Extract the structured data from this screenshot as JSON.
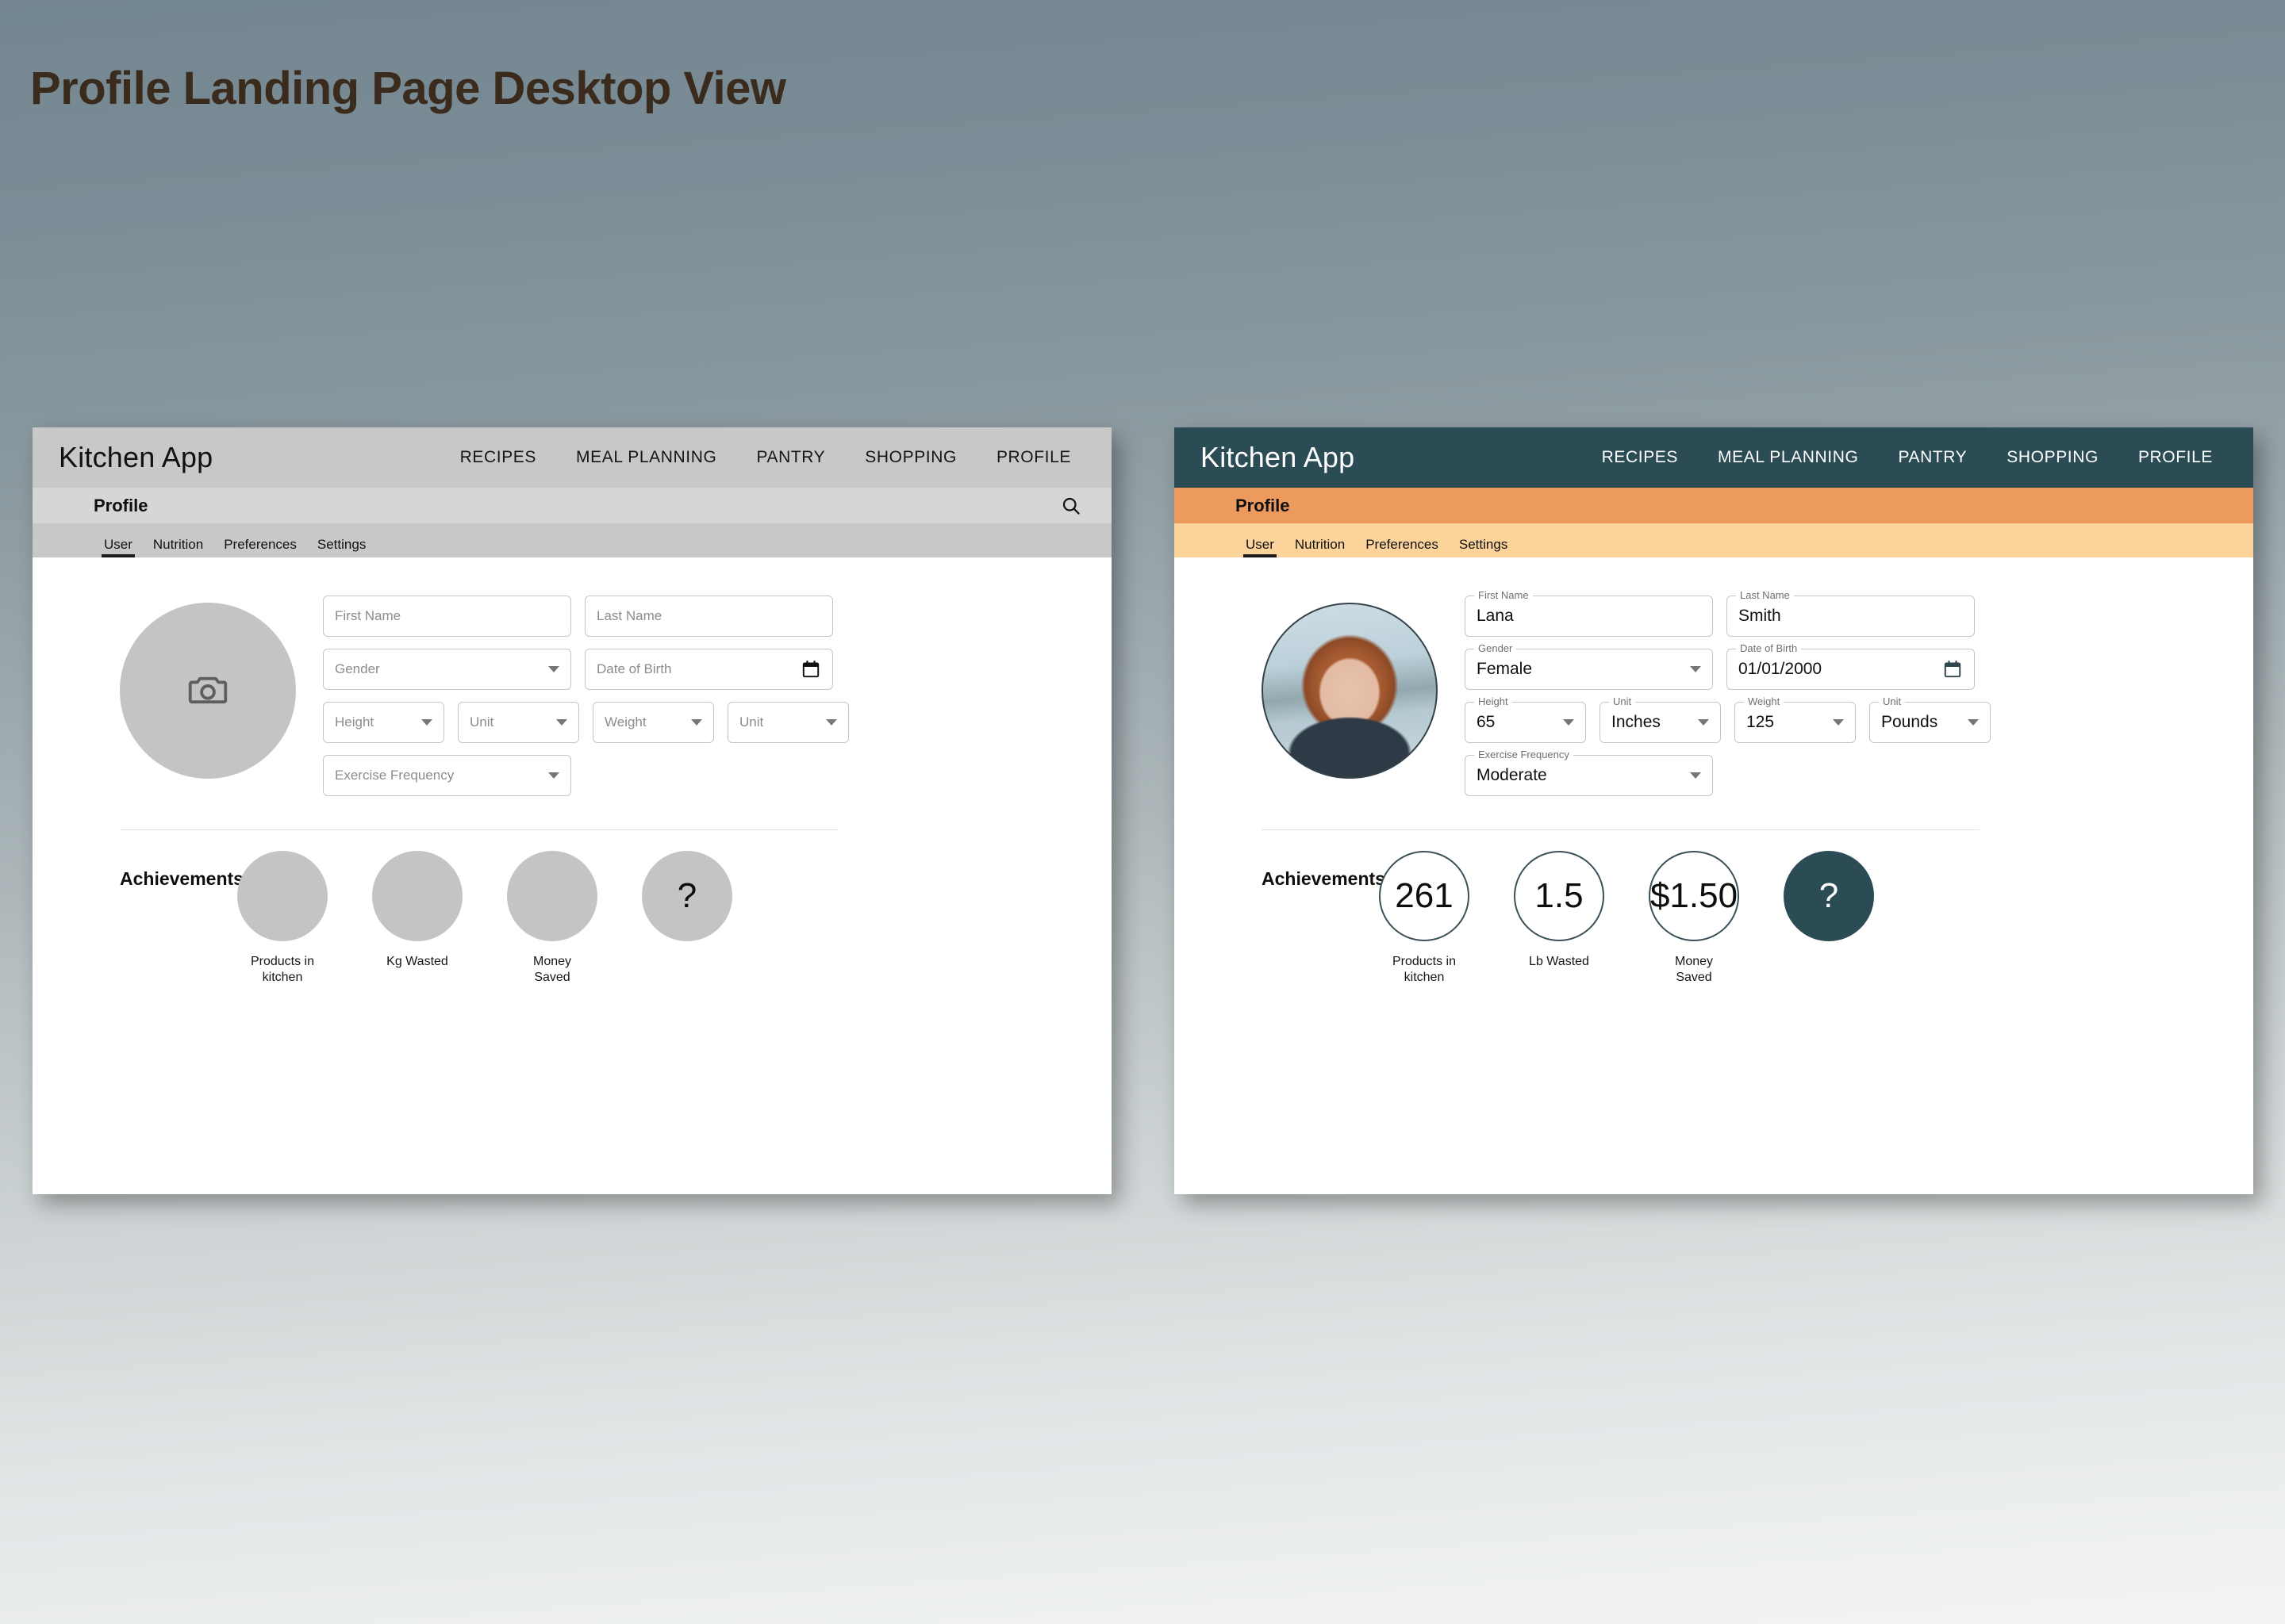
{
  "page": {
    "title": "Profile Landing Page Desktop View",
    "title_color": "#3a2b1c",
    "background_top_color": "#748791",
    "background_bottom_color": "#f2f3f4"
  },
  "mockups": [
    {
      "variant": "wireframe",
      "colors": {
        "appbar": "#c8c8c8",
        "subbar": "#d6d6d6",
        "tabbar": "#c8c8c8",
        "body": "#ffffff",
        "brand_text": "#111111",
        "nav_text": "#151515"
      },
      "appbar": {
        "brand": "Kitchen App",
        "nav": [
          {
            "label": "RECIPES"
          },
          {
            "label": "MEAL PLANNING"
          },
          {
            "label": "PANTRY"
          },
          {
            "label": "SHOPPING"
          },
          {
            "label": "PROFILE"
          }
        ]
      },
      "subbar": {
        "title": "Profile",
        "search_icon": "search-icon",
        "has_search": true
      },
      "tabs": [
        {
          "label": "User",
          "active": true
        },
        {
          "label": "Nutrition",
          "active": false
        },
        {
          "label": "Preferences",
          "active": false
        },
        {
          "label": "Settings",
          "active": false
        }
      ],
      "avatar": {
        "type": "placeholder",
        "icon": "camera-icon"
      },
      "form": {
        "rows": [
          [
            {
              "name": "first-name",
              "placeholder": "First Name",
              "value": "",
              "width": "wide",
              "control": "text"
            },
            {
              "name": "last-name",
              "placeholder": "Last Name",
              "value": "",
              "width": "wide",
              "control": "text"
            }
          ],
          [
            {
              "name": "gender",
              "placeholder": "Gender",
              "value": "",
              "width": "wide",
              "control": "select"
            },
            {
              "name": "date-of-birth",
              "placeholder": "Date of Birth",
              "value": "",
              "width": "wide",
              "control": "date"
            }
          ],
          [
            {
              "name": "height",
              "placeholder": "Height",
              "value": "",
              "width": "narrow",
              "control": "select"
            },
            {
              "name": "height-unit",
              "placeholder": "Unit",
              "value": "",
              "width": "narrow",
              "control": "select"
            },
            {
              "name": "weight",
              "placeholder": "Weight",
              "value": "",
              "width": "narrow",
              "control": "select"
            },
            {
              "name": "weight-unit",
              "placeholder": "Unit",
              "value": "",
              "width": "narrow",
              "control": "select"
            }
          ],
          [
            {
              "name": "exercise-frequency",
              "placeholder": "Exercise Frequency",
              "value": "",
              "width": "wide",
              "control": "select"
            }
          ]
        ]
      },
      "achievements": {
        "title": "Achievements",
        "items": [
          {
            "value": "",
            "label": "Products in\nkitchen",
            "style": "plain"
          },
          {
            "value": "",
            "label": "Kg Wasted",
            "style": "plain"
          },
          {
            "value": "",
            "label": "Money\nSaved",
            "style": "plain"
          },
          {
            "value": "?",
            "label": "",
            "style": "plain"
          }
        ]
      }
    },
    {
      "variant": "themed",
      "colors": {
        "appbar": "#2b4b55",
        "subbar": "#ed9a5e",
        "tabbar": "#fcd39a",
        "body": "#ffffff",
        "brand_text": "#ffffff",
        "nav_text": "#ffffff"
      },
      "appbar": {
        "brand": "Kitchen App",
        "nav": [
          {
            "label": "RECIPES"
          },
          {
            "label": "MEAL PLANNING"
          },
          {
            "label": "PANTRY"
          },
          {
            "label": "SHOPPING"
          },
          {
            "label": "PROFILE"
          }
        ]
      },
      "subbar": {
        "title": "Profile",
        "search_icon": "",
        "has_search": false
      },
      "tabs": [
        {
          "label": "User",
          "active": true
        },
        {
          "label": "Nutrition",
          "active": false
        },
        {
          "label": "Preferences",
          "active": false
        },
        {
          "label": "Settings",
          "active": false
        }
      ],
      "avatar": {
        "type": "photo",
        "icon": ""
      },
      "form": {
        "rows": [
          [
            {
              "name": "first-name",
              "placeholder": "First Name",
              "value": "Lana",
              "width": "wide",
              "control": "text"
            },
            {
              "name": "last-name",
              "placeholder": "Last Name",
              "value": "Smith",
              "width": "wide",
              "control": "text"
            }
          ],
          [
            {
              "name": "gender",
              "placeholder": "Gender",
              "value": "Female",
              "width": "wide",
              "control": "select"
            },
            {
              "name": "date-of-birth",
              "placeholder": "Date of Birth",
              "value": "01/01/2000",
              "width": "wide",
              "control": "date"
            }
          ],
          [
            {
              "name": "height",
              "placeholder": "Height",
              "value": "65",
              "width": "narrow",
              "control": "select"
            },
            {
              "name": "height-unit",
              "placeholder": "Unit",
              "value": "Inches",
              "width": "narrow",
              "control": "select"
            },
            {
              "name": "weight",
              "placeholder": "Weight",
              "value": "125",
              "width": "narrow",
              "control": "select"
            },
            {
              "name": "weight-unit",
              "placeholder": "Unit",
              "value": "Pounds",
              "width": "narrow",
              "control": "select"
            }
          ],
          [
            {
              "name": "exercise-frequency",
              "placeholder": "Exercise Frequency",
              "value": "Moderate",
              "width": "wide",
              "control": "select"
            }
          ]
        ]
      },
      "achievements": {
        "title": "Achievements",
        "items": [
          {
            "value": "261",
            "label": "Products in\nkitchen",
            "style": "outline"
          },
          {
            "value": "1.5",
            "label": "Lb Wasted",
            "style": "outline"
          },
          {
            "value": "$1.50",
            "label": "Money\nSaved",
            "style": "outline"
          },
          {
            "value": "?",
            "label": "",
            "style": "filled"
          }
        ]
      }
    }
  ]
}
